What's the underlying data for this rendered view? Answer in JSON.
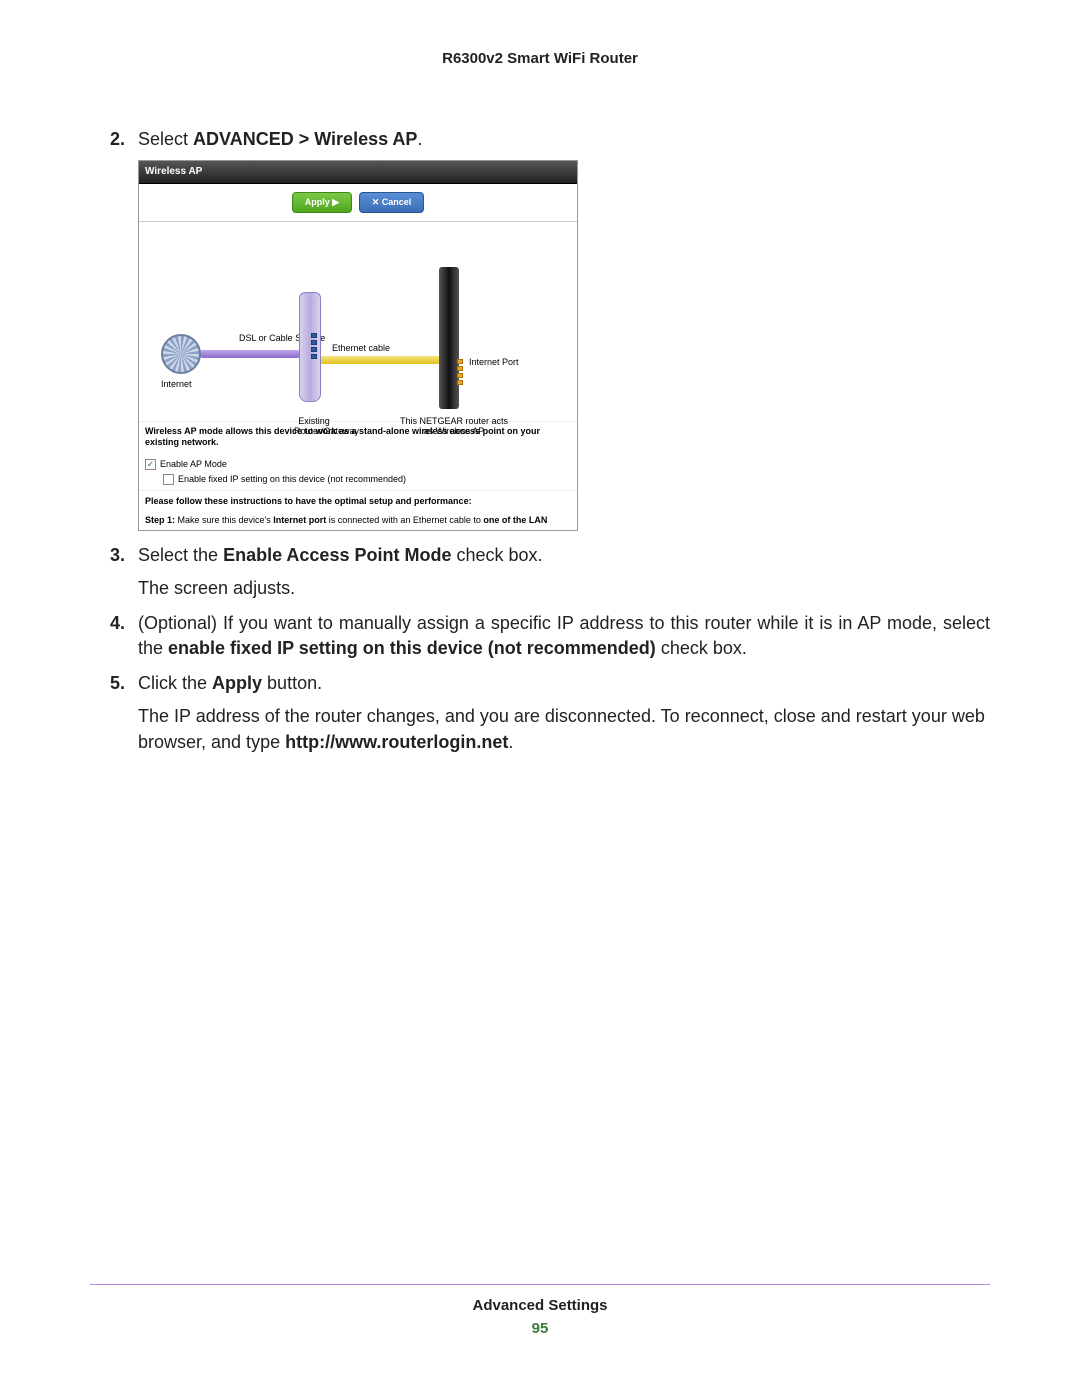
{
  "header": "R6300v2 Smart WiFi Router",
  "steps": {
    "s2": {
      "num": "2.",
      "pre": "Select ",
      "bold": "ADVANCED > Wireless AP",
      "post": "."
    },
    "s3": {
      "num": "3.",
      "pre": "Select the ",
      "bold": "Enable Access Point Mode",
      "post": " check box.",
      "sub": "The screen adjusts."
    },
    "s4": {
      "num": "4.",
      "pre": "(Optional) If you want to manually assign a specific IP address to this router while it is in AP mode, select the ",
      "bold": "enable fixed IP setting on this device (not recommended)",
      "post": " check box."
    },
    "s5": {
      "num": "5.",
      "pre": "Click the ",
      "bold": "Apply",
      "post": " button.",
      "sub_a": "The IP address of the router changes, and you are disconnected. To reconnect, close and restart your web browser, and type ",
      "sub_bold": "http://www.routerlogin.net",
      "sub_b": "."
    }
  },
  "shot": {
    "title": "Wireless AP",
    "apply": "Apply ▶",
    "cancel": "✕ Cancel",
    "internet": "Internet",
    "dsl": "DSL or Cable Service",
    "eth": "Ethernet cable",
    "internet_port": "Internet Port",
    "modem_caption": "Existing Router/Gateway",
    "ngr_caption": "This NETGEAR router acts as Wireless AP",
    "desc": "Wireless AP mode allows this device to work as a stand-alone wireless access point on your existing network.",
    "chk1": "Enable AP Mode",
    "chk2": "Enable fixed IP setting on this device (not recommended)",
    "instr": "Please follow these instructions to have the optimal setup and performance:",
    "step1_label": "Step 1:",
    "step1_a": " Make sure this device's ",
    "step1_bold1": "Internet port",
    "step1_b": " is connected with an Ethernet cable to ",
    "step1_bold2": "one of the LAN"
  },
  "footer": {
    "section": "Advanced Settings",
    "page": "95"
  }
}
